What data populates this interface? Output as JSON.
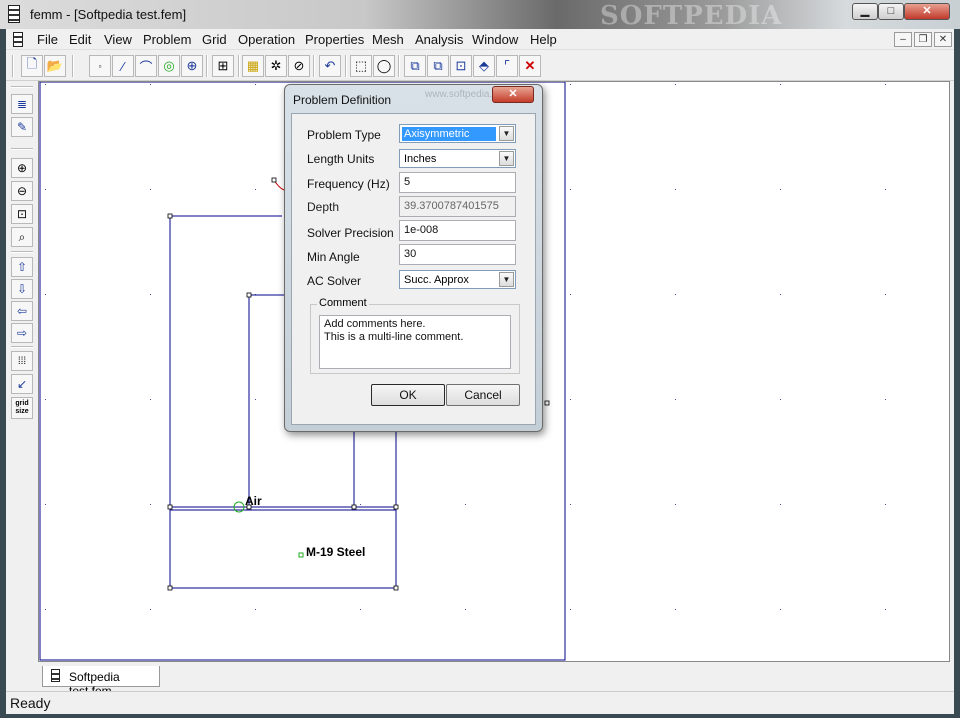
{
  "window": {
    "title": "femm - [Softpedia test.fem]",
    "watermark": "SOFTPEDIA",
    "controls": {
      "minimize": "▁",
      "maximize": "□",
      "close": "✕"
    }
  },
  "menu": [
    "File",
    "Edit",
    "View",
    "Problem",
    "Grid",
    "Operation",
    "Properties",
    "Mesh",
    "Analysis",
    "Window",
    "Help"
  ],
  "mdi_controls": {
    "minimize": "–",
    "restore": "❐",
    "close": "✕"
  },
  "toolbar": {
    "icons": [
      "new-file-icon",
      "open-folder-icon",
      "node-icon",
      "segment-icon",
      "arc-icon",
      "block-label-icon",
      "group-icon",
      "properties-icon",
      "materials-icon",
      "mesh-icon",
      "analyze-icon",
      "view-results-icon",
      "undo-icon",
      "select-rectangle-icon",
      "select-circle-icon",
      "copy-icon",
      "move-icon",
      "scale-icon",
      "mirror-icon",
      "fillet-icon",
      "delete-icon"
    ]
  },
  "left_toolbar": {
    "icons": [
      "show-list-icon",
      "edit-list-icon",
      "zoom-in-icon",
      "zoom-out-icon",
      "zoom-window-icon",
      "zoom-natural-icon",
      "pan-up-icon",
      "pan-down-icon",
      "pan-left-icon",
      "pan-right-icon",
      "show-grid-icon",
      "snap-grid-icon"
    ],
    "grid_size_label": "grid\nsize"
  },
  "canvas": {
    "labels": {
      "air": "Air",
      "steel": "M-19 Steel"
    }
  },
  "tabs": [
    {
      "label": "Softpedia test.fem"
    }
  ],
  "status": {
    "text": "Ready"
  },
  "dialog": {
    "title": "Problem Definition",
    "watermark": "www.softpedia.com",
    "close_label": "✕",
    "fields": {
      "problem_type": {
        "label": "Problem Type",
        "value": "Axisymmetric"
      },
      "length_units": {
        "label": "Length Units",
        "value": "Inches"
      },
      "frequency": {
        "label": "Frequency (Hz)",
        "value": "5"
      },
      "depth": {
        "label": "Depth",
        "value": "39.3700787401575"
      },
      "solver_precision": {
        "label": "Solver Precision",
        "value": "1e-008"
      },
      "min_angle": {
        "label": "Min Angle",
        "value": "30"
      },
      "ac_solver": {
        "label": "AC Solver",
        "value": "Succ. Approx"
      }
    },
    "comment": {
      "label": "Comment",
      "lines": [
        "Add comments here.",
        "This is a multi-line comment."
      ]
    },
    "ok_label": "OK",
    "cancel_label": "Cancel"
  },
  "colors": {
    "geometry": "#00008b",
    "dialog_selection": "#3399ff",
    "close_red": "#c43d2a"
  }
}
